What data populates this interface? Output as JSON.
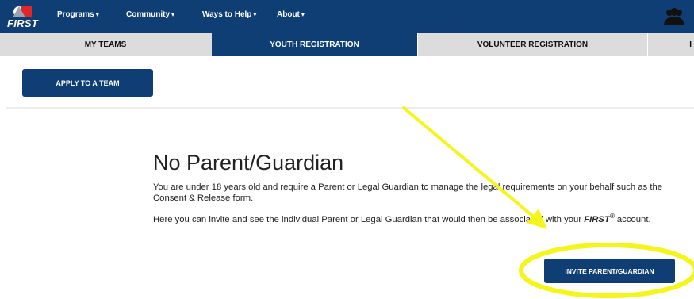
{
  "brand": {
    "logo_text": "FIRST"
  },
  "nav": {
    "items": [
      {
        "label": "Programs",
        "caret": "▾"
      },
      {
        "label": "Community",
        "caret": "▾"
      },
      {
        "label": "Ways to Help",
        "caret": "▾"
      },
      {
        "label": "About",
        "caret": "▾"
      }
    ]
  },
  "tabs": [
    {
      "label": "MY TEAMS",
      "active": false
    },
    {
      "label": "YOUTH REGISTRATION",
      "active": true
    },
    {
      "label": "VOLUNTEER REGISTRATION",
      "active": false
    },
    {
      "label": "I",
      "active": false
    }
  ],
  "actions": {
    "apply_label": "APPLY TO A TEAM",
    "invite_label": "INVITE PARENT/GUARDIAN"
  },
  "main": {
    "heading": "No Parent/Guardian",
    "para1": "You are under 18 years old and require a Parent or Legal Guardian to manage the legal requirements on your behalf such as the Consent & Release form.",
    "para2_before": "Here you can invite and see the individual Parent or Legal Guardian that would then be associated with your ",
    "para2_brand": "FIRST",
    "para2_reg": "®",
    "para2_after": " account."
  },
  "icons": {
    "logo": "first-logo-icon",
    "account": "user-group-icon",
    "annotation_arrow": "arrow-annotation",
    "annotation_circle": "highlight-ellipse"
  },
  "colors": {
    "brand_blue": "#0f3e74",
    "tab_gray": "#dcdcdc",
    "annotation_yellow": "#f4f51c",
    "logo_red": "#e1252a"
  }
}
